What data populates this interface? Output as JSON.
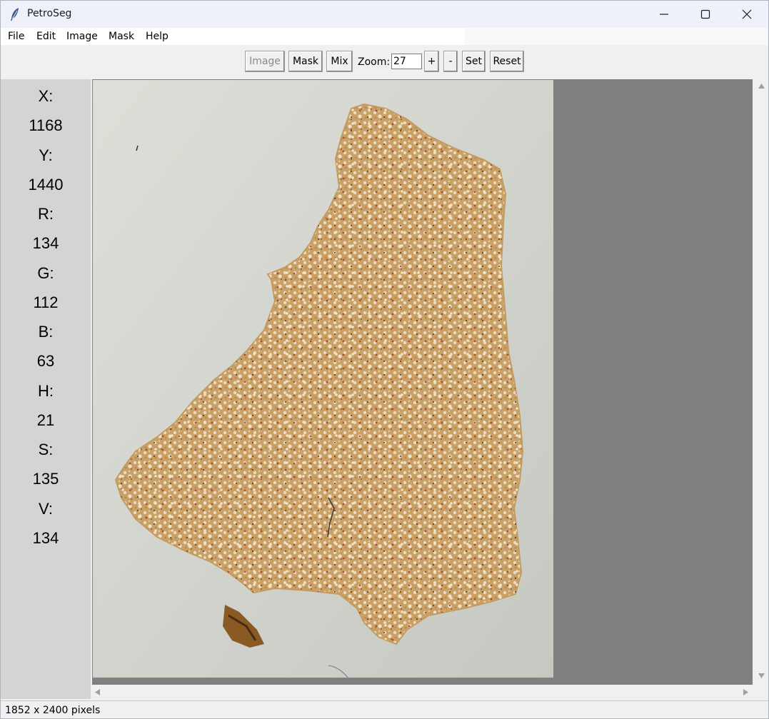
{
  "window": {
    "title": "PetroSeg"
  },
  "menu": {
    "items": [
      "File",
      "Edit",
      "Image",
      "Mask",
      "Help"
    ]
  },
  "toolbar": {
    "image_label": "Image",
    "mask_label": "Mask",
    "mix_label": "Mix",
    "zoom_label": "Zoom:",
    "zoom_value": "27",
    "zoom_in_label": "+",
    "zoom_out_label": "-",
    "set_label": "Set",
    "reset_label": "Reset"
  },
  "pixel_info": {
    "x_label": "X:",
    "x_value": "1168",
    "y_label": "Y:",
    "y_value": "1440",
    "r_label": "R:",
    "r_value": "134",
    "g_label": "G:",
    "g_value": "112",
    "b_label": "B:",
    "b_value": "63",
    "h_label": "H:",
    "h_value": "21",
    "s_label": "S:",
    "s_value": "135",
    "v_label": "V:",
    "v_value": "134"
  },
  "status": {
    "text": "1852 x 2400 pixels"
  },
  "colors": {
    "sample_tan": "#c9a66b",
    "background_gray": "#808080",
    "slide_background": "#d8dad3"
  },
  "icons": {
    "app": "feather-icon",
    "minimize": "minimize-icon",
    "maximize": "maximize-icon",
    "close": "close-icon",
    "scroll_up": "triangle-up-icon",
    "scroll_down": "triangle-down-icon",
    "scroll_left": "triangle-left-icon",
    "scroll_right": "triangle-right-icon"
  }
}
